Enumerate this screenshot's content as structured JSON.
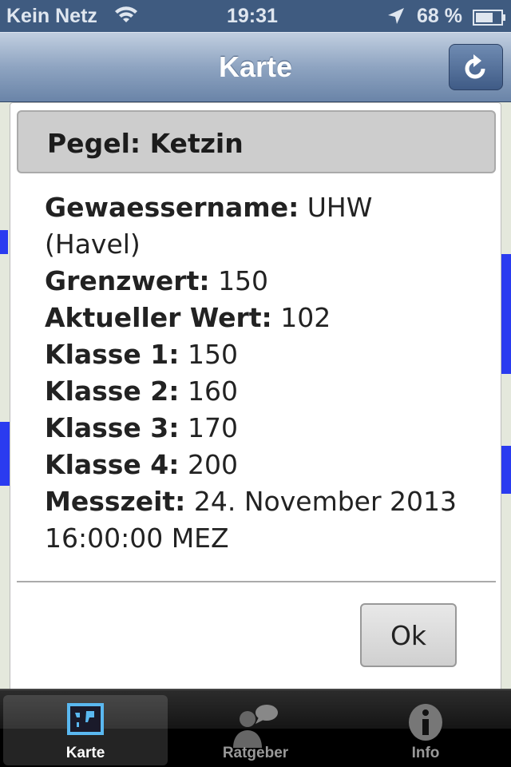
{
  "status_bar": {
    "carrier": "Kein Netz",
    "time": "19:31",
    "battery": "68 %",
    "icons": [
      "wifi-icon",
      "location-arrow-icon",
      "battery-icon"
    ]
  },
  "nav": {
    "title": "Karte",
    "refresh_icon": "refresh-icon"
  },
  "dialog": {
    "title": "Pegel: Ketzin",
    "fields": [
      {
        "label": "Gewaessername:",
        "value": "UHW (Havel)"
      },
      {
        "label": "Grenzwert:",
        "value": "150"
      },
      {
        "label": "Aktueller Wert:",
        "value": "102"
      },
      {
        "label": "Klasse 1:",
        "value": "150"
      },
      {
        "label": "Klasse 2:",
        "value": "160"
      },
      {
        "label": "Klasse 3:",
        "value": "170"
      },
      {
        "label": "Klasse 4:",
        "value": "200"
      },
      {
        "label": "Messzeit:",
        "value": "24. November 2013 16:00:00 MEZ"
      }
    ],
    "ok_label": "Ok"
  },
  "tabs": [
    {
      "label": "Karte",
      "icon": "map-icon",
      "active": true
    },
    {
      "label": "Ratgeber",
      "icon": "advisor-chat-icon",
      "active": false
    },
    {
      "label": "Info",
      "icon": "info-icon",
      "active": false
    }
  ],
  "colors": {
    "nav": "#6a84a8",
    "status": "#3f5b80",
    "river": "#2a3bf0"
  }
}
